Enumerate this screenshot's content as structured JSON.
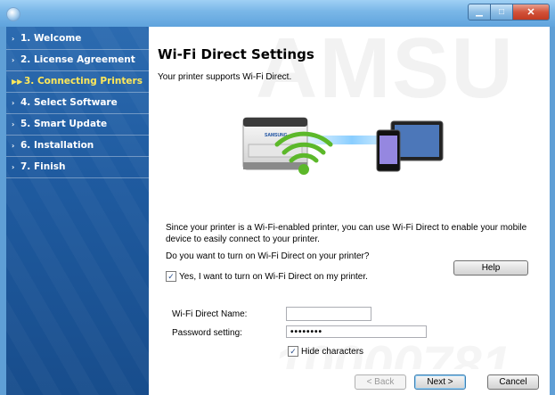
{
  "window": {
    "minimize_glyph": "▁",
    "maximize_glyph": "□",
    "close_glyph": "✕"
  },
  "sidebar": {
    "steps": [
      {
        "label": "1. Welcome",
        "arrow": "›"
      },
      {
        "label": "2. License Agreement",
        "arrow": "›"
      },
      {
        "label": "3. Connecting Printers",
        "arrow": "▶▶"
      },
      {
        "label": "4. Select Software",
        "arrow": "›"
      },
      {
        "label": "5. Smart Update",
        "arrow": "›"
      },
      {
        "label": "6. Installation",
        "arrow": "›"
      },
      {
        "label": "7. Finish",
        "arrow": "›"
      }
    ],
    "active_color": "#ffe85a"
  },
  "main": {
    "watermark": "AMSU",
    "watermark_bottom": "10000781",
    "title": "Wi-Fi Direct Settings",
    "subtitle": "Your printer supports Wi-Fi Direct.",
    "description": "Since your printer is a Wi-Fi-enabled printer, you can use Wi-Fi Direct to enable your mobile device to easily connect to your printer.",
    "question": "Do you want to turn on Wi-Fi Direct on your printer?",
    "help_label": "Help",
    "enable_label": "Yes, I want to turn on Wi-Fi Direct on my printer.",
    "enable_checked_glyph": "✓",
    "name_label": "Wi-Fi Direct Name:",
    "name_value": "",
    "password_label": "Password setting:",
    "password_value": "••••••••",
    "hide_label": "Hide characters",
    "hide_checked_glyph": "✓",
    "printer_brand": "SAMSUNG"
  },
  "footer": {
    "back_label": "< Back",
    "next_label": "Next >",
    "cancel_label": "Cancel"
  },
  "icons": {
    "app": "app-globe-icon",
    "wifi": "wifi-icon",
    "printer": "printer-icon",
    "tablet": "tablet-icon",
    "phone": "phone-icon"
  },
  "colors": {
    "title_bar": "#7bb8e8",
    "sidebar": "#1f5ba0",
    "wifi_green": "#5cb82a",
    "active_step": "#ffe85a"
  }
}
